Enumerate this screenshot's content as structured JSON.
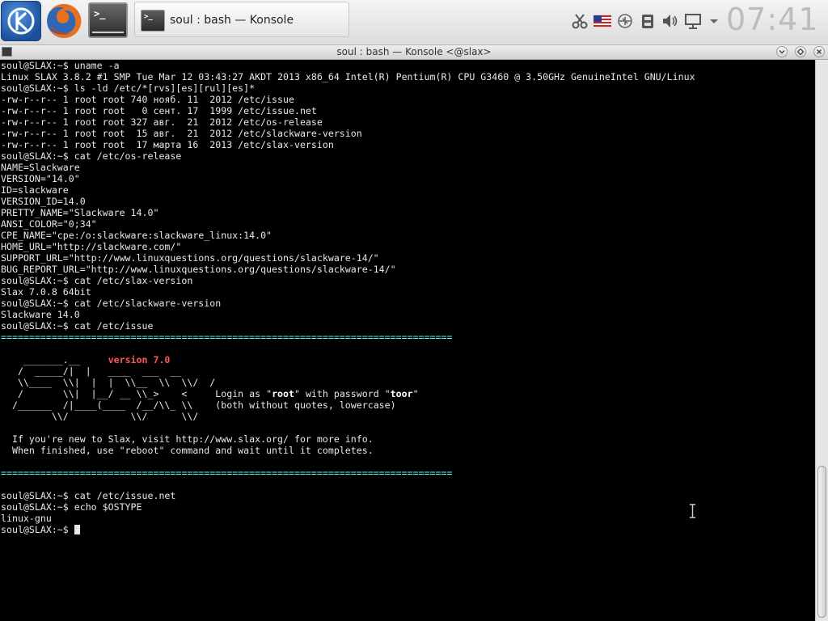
{
  "panel": {
    "launchers": [
      {
        "name": "kde-menu",
        "icon": "kde-logo-icon"
      },
      {
        "name": "firefox",
        "icon": "firefox-icon"
      },
      {
        "name": "konsole",
        "icon": "terminal-icon",
        "glyph": ">_"
      }
    ],
    "task_label": "soul : bash — Konsole",
    "task_icon_glyph": ">_",
    "tray_icons": [
      "scissors-icon",
      "us-flag-icon",
      "usb-icon",
      "device-notifier-icon",
      "volume-icon",
      "display-icon",
      "chevron-down-icon"
    ],
    "clock": "07:41"
  },
  "window": {
    "title": "soul : bash — Konsole <@slax>",
    "buttons": [
      "minimize-button",
      "maximize-button",
      "close-button"
    ]
  },
  "terminal": {
    "lines": [
      "soul@SLAX:~$ uname -a",
      "Linux SLAX 3.8.2 #1 SMP Tue Mar 12 03:43:27 AKDT 2013 x86_64 Intel(R) Pentium(R) CPU G3460 @ 3.50GHz GenuineIntel GNU/Linux",
      "soul@SLAX:~$ ls -ld /etc/*[rvs][es][rul][es]*",
      "-rw-r--r-- 1 root root 740 нояб. 11  2012 /etc/issue",
      "-rw-r--r-- 1 root root   0 сент. 17  1999 /etc/issue.net",
      "-rw-r--r-- 1 root root 327 авг.  21  2012 /etc/os-release",
      "-rw-r--r-- 1 root root  15 авг.  21  2012 /etc/slackware-version",
      "-rw-r--r-- 1 root root  17 марта 16  2013 /etc/slax-version",
      "soul@SLAX:~$ cat /etc/os-release",
      "NAME=Slackware",
      "VERSION=\"14.0\"",
      "ID=slackware",
      "VERSION_ID=14.0",
      "PRETTY_NAME=\"Slackware 14.0\"",
      "ANSI_COLOR=\"0;34\"",
      "CPE_NAME=\"cpe:/o:slackware:slackware_linux:14.0\"",
      "HOME_URL=\"http://slackware.com/\"",
      "SUPPORT_URL=\"http://www.linuxquestions.org/questions/slackware-14/\"",
      "BUG_REPORT_URL=\"http://www.linuxquestions.org/questions/slackware-14/\"",
      "soul@SLAX:~$ cat /etc/slax-version",
      "Slax 7.0.8 64bit",
      "soul@SLAX:~$ cat /etc/slackware-version",
      "Slackware 14.0",
      "soul@SLAX:~$ cat /etc/issue"
    ],
    "separator": "================================================================================",
    "banner": {
      "art1": "    _______.__     ",
      "version": "version 7.0",
      "art2": "   /  _____/|  |   ____  ___  __",
      "art3": "   \\\\____  \\\\|  |  |  \\\\__  \\\\  \\\\/  /",
      "art4a": "   /       \\\\|  |__/ __ \\\\_>    <     ",
      "art4b": "Login as \"",
      "root": "root",
      "art4c": "\" with password \"",
      "pw": "toor",
      "art4d": "\"",
      "art5a": "  /______  /|____(____  /__/\\\\_ \\\\    ",
      "art5b": "(both without quotes, lowercase)",
      "art6": "         \\\\/           \\\\/      \\\\/",
      "info1": "  If you're new to Slax, visit http://www.slax.org/ for more info.",
      "info2": "  When finished, use \"reboot\" command and wait until it completes."
    },
    "after": [
      "soul@SLAX:~$ cat /etc/issue.net",
      "soul@SLAX:~$ echo $OSTYPE",
      "linux-gnu"
    ],
    "prompt": "soul@SLAX:~$ "
  }
}
